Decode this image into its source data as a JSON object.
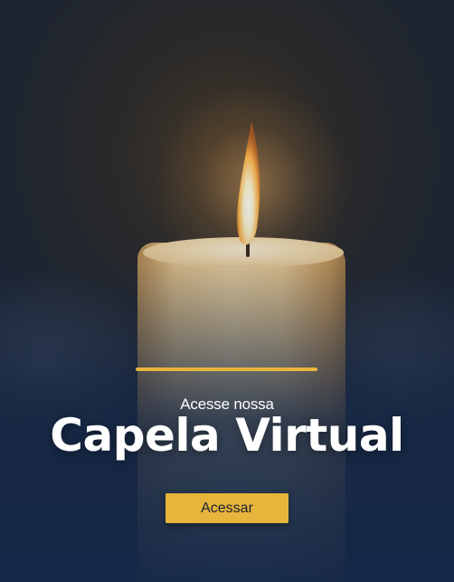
{
  "banner": {
    "subtitle": "Acesse nossa",
    "title": "Capela Virtual",
    "cta_label": "Acessar"
  },
  "colors": {
    "accent": "#e7b53c",
    "background": "#162a48",
    "text": "#ffffff"
  },
  "icons": {
    "hero_image": "candle-flame-photo"
  }
}
